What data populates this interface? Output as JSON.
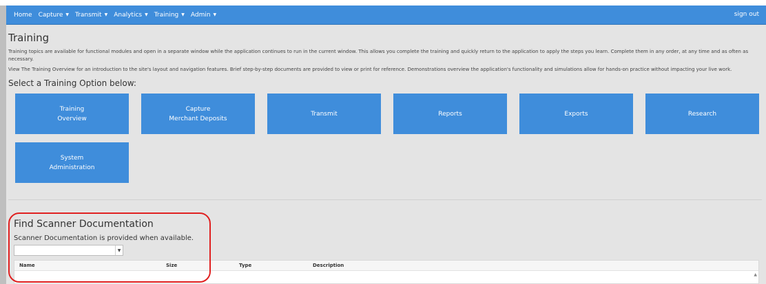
{
  "nav": {
    "items": [
      {
        "label": "Home",
        "dropdown": false
      },
      {
        "label": "Capture",
        "dropdown": true
      },
      {
        "label": "Transmit",
        "dropdown": true
      },
      {
        "label": "Analytics",
        "dropdown": true
      },
      {
        "label": "Training",
        "dropdown": true
      },
      {
        "label": "Admin",
        "dropdown": true
      }
    ],
    "sign_out": "sign out"
  },
  "page": {
    "title": "Training",
    "para1": "Training topics are available for functional modules and open in a separate window while the application continues to run in the current window. This allows you complete the training and quickly return to the application to apply the steps you learn.  Complete them in any order, at any time and as often as necessary.",
    "para2": "View The Training Overview for an introduction to the site's layout and navigation features. Brief step-by-step documents are provided to view or print for reference. Demonstrations overview the application's functionality and simulations allow for hands-on practice without impacting your live work.",
    "select_heading": "Select a Training Option below:"
  },
  "training_options": [
    {
      "line1": "Training",
      "line2": "Overview"
    },
    {
      "line1": "Capture",
      "line2": "Merchant Deposits"
    },
    {
      "line1": "Transmit",
      "line2": ""
    },
    {
      "line1": "Reports",
      "line2": ""
    },
    {
      "line1": "Exports",
      "line2": ""
    },
    {
      "line1": "Research",
      "line2": ""
    },
    {
      "line1": "System",
      "line2": "Administration"
    }
  ],
  "scanner": {
    "title": "Find Scanner Documentation",
    "subtitle": "Scanner Documentation is provided when available.",
    "selected_value": "",
    "columns": [
      "Name",
      "Size",
      "Type",
      "Description"
    ]
  },
  "colors": {
    "nav_bg": "#3f8ddb",
    "button_bg": "#3f8ddb",
    "content_bg": "#e4e4e4",
    "highlight": "#e02020"
  }
}
